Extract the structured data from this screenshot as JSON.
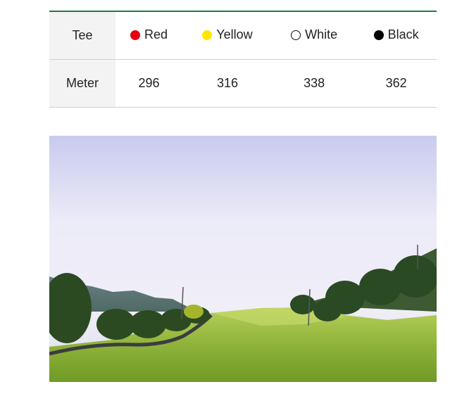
{
  "tee_table": {
    "tee_header": "Tee",
    "meter_header": "Meter",
    "tees": [
      {
        "label": "Red",
        "color": "#e60012",
        "meters": "296"
      },
      {
        "label": "Yellow",
        "color": "#ffe600",
        "meters": "316"
      },
      {
        "label": "White",
        "color": "#ffffff",
        "meters": "338"
      },
      {
        "label": "Black",
        "color": "#000000",
        "meters": "362"
      }
    ],
    "accent_color": "#1f7a3f"
  },
  "photo": {
    "icon": "golf-course-fairway-photo"
  }
}
